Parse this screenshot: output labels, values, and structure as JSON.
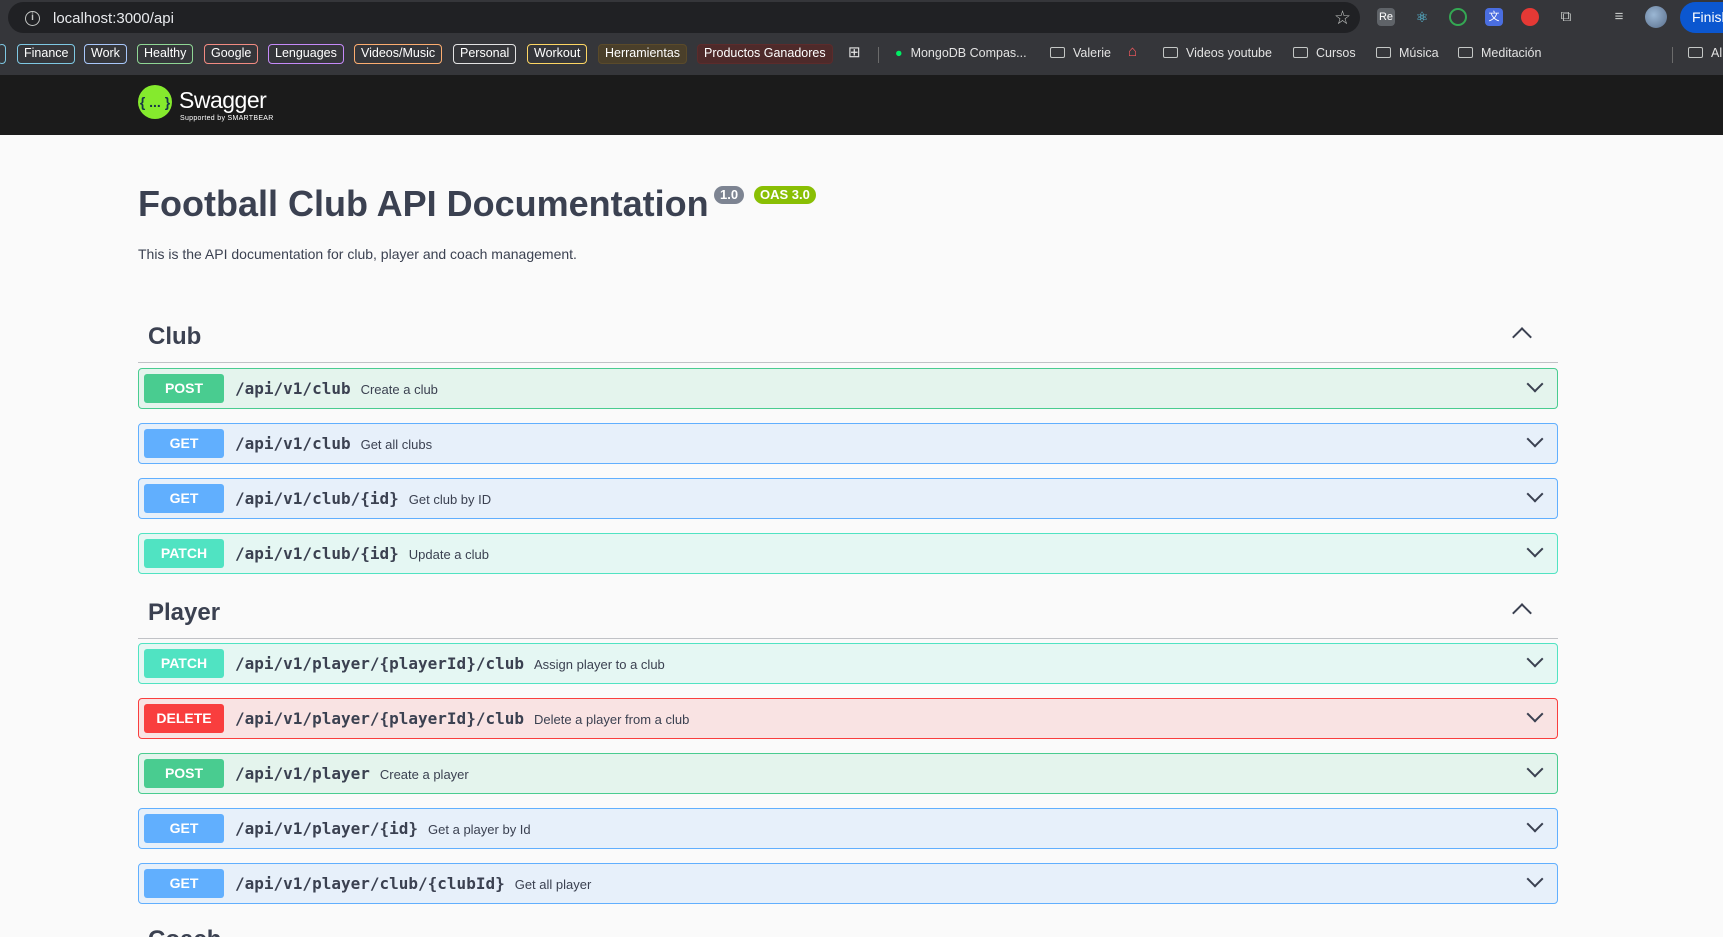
{
  "browser": {
    "url": "localhost:3000/api",
    "profile_button": "Finish",
    "bookmark_tags": [
      {
        "label": "Finance",
        "color": "#7ec8e3"
      },
      {
        "label": "Work",
        "color": "#a8c7fa"
      },
      {
        "label": "Healthy",
        "color": "#8fd694"
      },
      {
        "label": "Google",
        "color": "#f28b82"
      },
      {
        "label": "Lenguages",
        "color": "#c58af9"
      },
      {
        "label": "Videos/Music",
        "color": "#fcad70"
      },
      {
        "label": "Personal",
        "color": "#e3e3e3"
      },
      {
        "label": "Workout",
        "color": "#fdd663"
      },
      {
        "label": "Herramientas",
        "color": "#5a4a2a"
      },
      {
        "label": "Productos Ganadores",
        "color": "#5c2b2b"
      }
    ],
    "bookmark_folders": [
      "MongoDB Compas...",
      "Valerie",
      "Videos youtube",
      "Cursos",
      "Música",
      "Meditación",
      "Al"
    ]
  },
  "swagger": {
    "logo_text": "{ ... }",
    "name": "Swagger",
    "supported_by": "Supported by SMARTBEAR"
  },
  "info": {
    "title": "Football Club API Documentation",
    "version": "1.0",
    "oas": "OAS 3.0",
    "description": "This is the API documentation for club, player and coach management."
  },
  "sections": [
    {
      "name": "Club",
      "operations": [
        {
          "method": "POST",
          "path": "/api/v1/club",
          "summary": "Create a club"
        },
        {
          "method": "GET",
          "path": "/api/v1/club",
          "summary": "Get all clubs"
        },
        {
          "method": "GET",
          "path": "/api/v1/club/{id}",
          "summary": "Get club by ID"
        },
        {
          "method": "PATCH",
          "path": "/api/v1/club/{id}",
          "summary": "Update a club"
        }
      ]
    },
    {
      "name": "Player",
      "operations": [
        {
          "method": "PATCH",
          "path": "/api/v1/player/{playerId}/club",
          "summary": "Assign player to a club"
        },
        {
          "method": "DELETE",
          "path": "/api/v1/player/{playerId}/club",
          "summary": "Delete a player from a club"
        },
        {
          "method": "POST",
          "path": "/api/v1/player",
          "summary": "Create a player"
        },
        {
          "method": "GET",
          "path": "/api/v1/player/{id}",
          "summary": "Get a player by Id"
        },
        {
          "method": "GET",
          "path": "/api/v1/player/club/{clubId}",
          "summary": "Get all player"
        }
      ]
    }
  ],
  "next_section": "Coach",
  "colors": {
    "post": "#49cc90",
    "get": "#61affe",
    "patch": "#50e3c2",
    "delete": "#f93e3e"
  }
}
